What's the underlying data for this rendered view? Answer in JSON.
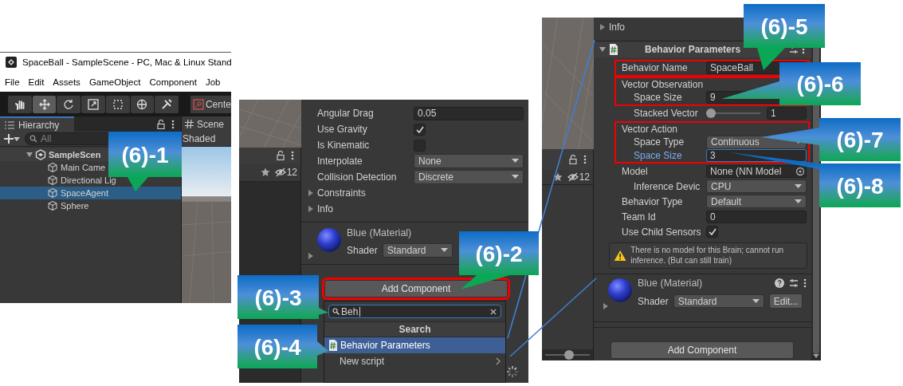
{
  "editor_window": {
    "title": "SpaceBall - SampleScene - PC, Mac & Linux Stand",
    "menu": [
      "File",
      "Edit",
      "Assets",
      "GameObject",
      "Component",
      "Job"
    ],
    "tools": [
      {
        "selected": false
      },
      {
        "selected": true
      },
      {
        "selected": false
      },
      {
        "selected": false
      },
      {
        "selected": false
      },
      {
        "selected": false
      },
      {
        "selected": false
      }
    ],
    "pivot_button": "Cente",
    "hierarchy": {
      "tab": "Hierarchy",
      "search_placeholder": "All",
      "tree": [
        {
          "label": "SampleScen",
          "selected": false,
          "expanded": true,
          "children": [
            {
              "label": "Main Came",
              "selected": false
            },
            {
              "label": "Directional Lig",
              "selected": false
            },
            {
              "label": "SpaceAgent",
              "selected": true
            },
            {
              "label": "Sphere",
              "selected": false
            }
          ]
        }
      ]
    },
    "scene": {
      "tab": "Scene",
      "shading_mode": "Shaded"
    }
  },
  "add_component_view": {
    "scene_strip": {
      "hidden_count": "12"
    },
    "rows": [
      {
        "kind": "field",
        "label": "Angular Drag",
        "value": "0.05"
      },
      {
        "kind": "checkbox",
        "label": "Use Gravity",
        "checked": true
      },
      {
        "kind": "checkbox",
        "label": "Is Kinematic",
        "checked": false
      },
      {
        "kind": "dropdown",
        "label": "Interpolate",
        "value": "None"
      },
      {
        "kind": "dropdown",
        "label": "Collision Detection",
        "value": "Discrete"
      },
      {
        "kind": "foldout",
        "label": "Constraints",
        "expanded": false
      },
      {
        "kind": "foldout",
        "label": "Info",
        "expanded": false
      }
    ],
    "material": {
      "name": "Blue (Material)",
      "shader_label": "Shader",
      "shader": "Standard"
    },
    "add_button": {
      "label": "Add Component",
      "highlighted": true
    },
    "popup": {
      "query": "Beh",
      "heading": "Search",
      "items": [
        {
          "kind": "script",
          "label": "Behavior Parameters",
          "selected": true
        },
        {
          "kind": "submenu",
          "label": "New script",
          "selected": false
        }
      ]
    }
  },
  "behavior_view": {
    "scene_strip": {
      "hidden_count": "12",
      "zoom_slider": {
        "level": 0.55
      }
    },
    "rows": [
      {
        "kind": "foldout",
        "label": "Info",
        "expanded": false
      }
    ],
    "component": {
      "title": "Behavior Parameters",
      "expanded": true,
      "rows": [
        {
          "kind": "group",
          "highlighted": true,
          "rows": [
            {
              "kind": "field",
              "label": "Behavior Name",
              "value": "SpaceBall"
            }
          ]
        },
        {
          "kind": "group",
          "highlighted": true,
          "rows": [
            {
              "kind": "heading",
              "label": "Vector Observation"
            },
            {
              "kind": "field",
              "label": "Space Size",
              "value": "9",
              "indented": true
            }
          ]
        },
        {
          "kind": "slider",
          "label": "Stacked Vector",
          "value": "1",
          "level": 0,
          "indented": true
        },
        {
          "kind": "group",
          "highlighted": true,
          "rows": [
            {
              "kind": "heading",
              "label": "Vector Action"
            },
            {
              "kind": "dropdown",
              "label": "Space Type",
              "value": "Continuous",
              "indented": true
            },
            {
              "kind": "field",
              "label": "Space Size",
              "value": "3",
              "indented": true,
              "focused": true
            }
          ]
        },
        {
          "kind": "object",
          "label": "Model",
          "value": "None (NN Model"
        },
        {
          "kind": "dropdown",
          "label": "Inference Devic",
          "value": "CPU",
          "indented": true
        },
        {
          "kind": "dropdown",
          "label": "Behavior Type",
          "value": "Default"
        },
        {
          "kind": "field",
          "label": "Team Id",
          "value": "0"
        },
        {
          "kind": "checkbox",
          "label": "Use Child Sensors",
          "checked": true
        }
      ],
      "warning": "There is no model for this Brain; cannot run inference. (But can still train)"
    },
    "material": {
      "name": "Blue (Material)",
      "shader_label": "Shader",
      "shader": "Standard",
      "edit_button": "Edit..."
    },
    "add_button": {
      "label": "Add Component",
      "highlighted": false
    }
  },
  "callouts": [
    {
      "label": "(6)-1"
    },
    {
      "label": "(6)-2"
    },
    {
      "label": "(6)-3"
    },
    {
      "label": "(6)-4"
    },
    {
      "label": "(6)-5"
    },
    {
      "label": "(6)-6"
    },
    {
      "label": "(6)-7"
    },
    {
      "label": "(6)-8"
    }
  ]
}
